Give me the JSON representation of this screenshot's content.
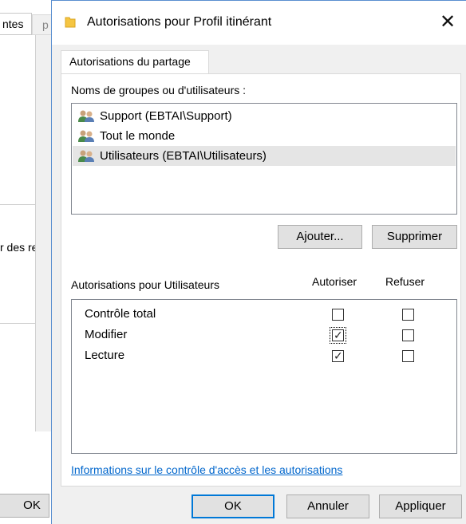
{
  "background_window": {
    "tab_1": "ntes",
    "tab_2": "p",
    "text": "r des re",
    "ok_label": "OK"
  },
  "dialog": {
    "title": "Autorisations pour Profil itinérant",
    "close_glyph": "✕",
    "tab_label": "Autorisations du partage",
    "groups_label": "Noms de groupes ou d'utilisateurs :",
    "groups": [
      {
        "name": "Support (EBTAI\\Support)",
        "icon": "users-group-icon",
        "selected": false
      },
      {
        "name": "Tout le monde",
        "icon": "users-group-icon",
        "selected": false
      },
      {
        "name": "Utilisateurs (EBTAI\\Utilisateurs)",
        "icon": "users-group-icon",
        "selected": true
      }
    ],
    "add_button": "Ajouter...",
    "remove_button": "Supprimer",
    "permissions_label": "Autorisations pour Utilisateurs",
    "allow_header": "Autoriser",
    "deny_header": "Refuser",
    "permissions": [
      {
        "name": "Contrôle total",
        "allow": false,
        "deny": false
      },
      {
        "name": "Modifier",
        "allow": true,
        "deny": false
      },
      {
        "name": "Lecture",
        "allow": true,
        "deny": false
      }
    ],
    "info_link": "Informations sur le contrôle d'accès et les autorisations",
    "ok_button": "OK",
    "cancel_button": "Annuler",
    "apply_button": "Appliquer"
  },
  "colors": {
    "accent": "#0078d7",
    "link": "#0066cc",
    "dialog_bg": "#f0f0f0",
    "selected_row": "#e5e5e5"
  }
}
